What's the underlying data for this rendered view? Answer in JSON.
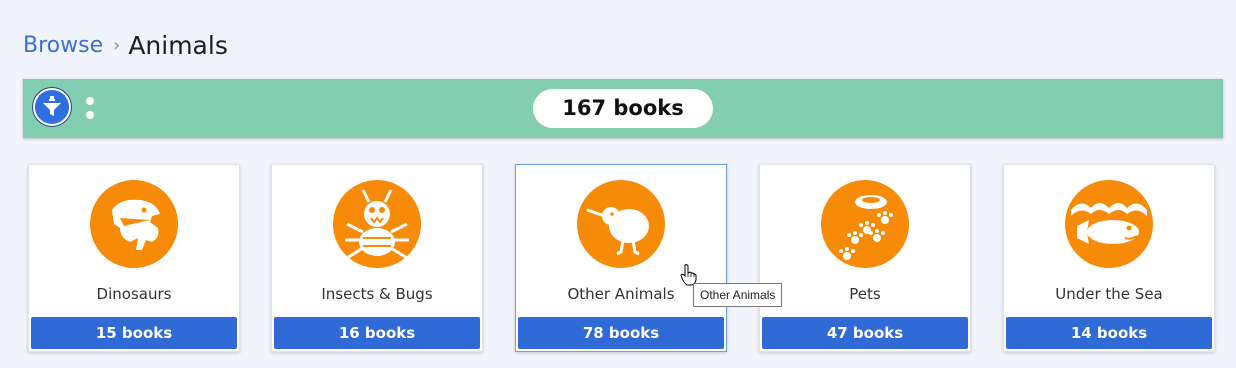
{
  "breadcrumb": {
    "parent": "Browse",
    "separator": "›",
    "current": "Animals"
  },
  "toolbar": {
    "filter_icon": "filter-funnel-icon",
    "more_icon": "more-options-icon",
    "total": "167 books"
  },
  "colors": {
    "accent": "#2f6ad7",
    "bar": "#83cdb1",
    "icon_bg": "#f78a06",
    "background": "#f1f4fc"
  },
  "categories": [
    {
      "label": "Dinosaurs",
      "count": "15 books",
      "icon": "dinosaur-icon"
    },
    {
      "label": "Insects & Bugs",
      "count": "16 books",
      "icon": "bug-icon"
    },
    {
      "label": "Other Animals",
      "count": "78 books",
      "icon": "kiwi-bird-icon"
    },
    {
      "label": "Pets",
      "count": "47 books",
      "icon": "paw-bowl-icon"
    },
    {
      "label": "Under the Sea",
      "count": "14 books",
      "icon": "fish-wave-icon"
    }
  ],
  "tooltip": "Other Animals"
}
